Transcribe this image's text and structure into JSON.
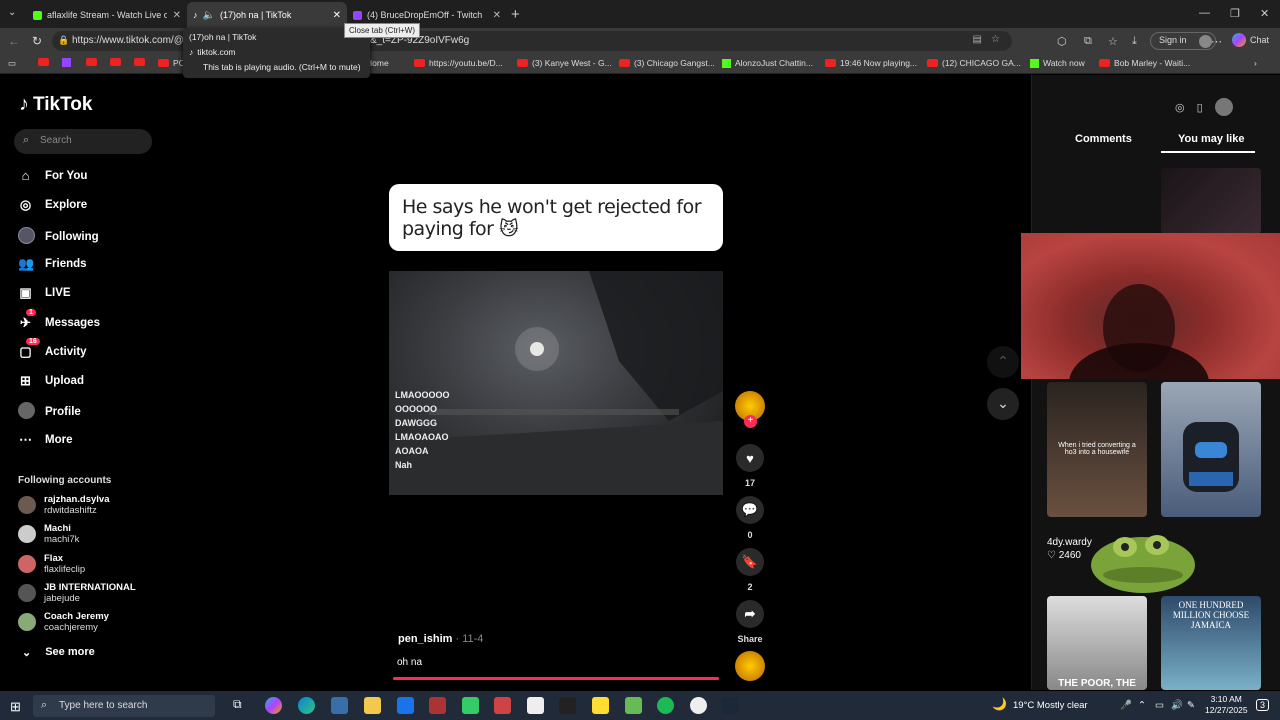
{
  "browser": {
    "tabs": [
      {
        "title": "aflaxlife Stream - Watch Live on Ki",
        "active": false
      },
      {
        "title": "(17)oh na | TikTok",
        "active": true
      },
      {
        "title": "(4) BruceDropEmOff - Twitch",
        "active": false
      }
    ],
    "close_tooltip": "Close tab (Ctrl+W)",
    "hover_card": {
      "title": "(17)oh na | TikTok",
      "domain": "tiktok.com",
      "audio_note": "This tab is playing audio. (Ctrl+M to mute)"
    },
    "url": "https://www.tiktok.com/@p",
    "url_tail": "&_t=ZP-92Z9oIVFw6g",
    "signin_label": "Sign in",
    "chat_label": "Chat",
    "bookmarks": [
      {
        "label": "PC",
        "kind": "youtube"
      },
      {
        "label": "Home",
        "kind": "plain"
      },
      {
        "label": "https://youtu.be/D...",
        "kind": "youtube"
      },
      {
        "label": "(3) Kanye West - G...",
        "kind": "youtube"
      },
      {
        "label": "(3) Chicago Gangst...",
        "kind": "youtube"
      },
      {
        "label": "AlonzoJust Chattin...",
        "kind": "kick"
      },
      {
        "label": "19:46 Now playing...",
        "kind": "youtube"
      },
      {
        "label": "(12) CHICAGO GA...",
        "kind": "youtube"
      },
      {
        "label": "Watch now",
        "kind": "kick"
      },
      {
        "label": "Bob Marley - Waiti...",
        "kind": "youtube"
      }
    ]
  },
  "tiktok": {
    "logo": "TikTok",
    "search_placeholder": "Search",
    "nav": [
      {
        "label": "For You",
        "icon": "home-icon"
      },
      {
        "label": "Explore",
        "icon": "compass-icon"
      },
      {
        "label": "Following",
        "icon": "following-icon"
      },
      {
        "label": "Friends",
        "icon": "friends-icon"
      },
      {
        "label": "LIVE",
        "icon": "live-icon"
      },
      {
        "label": "Messages",
        "icon": "messages-icon",
        "badge": "1"
      },
      {
        "label": "Activity",
        "icon": "activity-icon",
        "badge": "16"
      },
      {
        "label": "Upload",
        "icon": "upload-icon"
      },
      {
        "label": "Profile",
        "icon": "profile-icon"
      },
      {
        "label": "More",
        "icon": "more-icon"
      }
    ],
    "following_title": "Following accounts",
    "following": [
      {
        "name": "rajzhan.dsylva",
        "handle": "rdwitdashiftz"
      },
      {
        "name": "Machi",
        "handle": "machi7k"
      },
      {
        "name": "Flax",
        "handle": "flaxlifeclip"
      },
      {
        "name": "JB INTERNATIONAL",
        "handle": "jabejude"
      },
      {
        "name": "Coach Jeremy",
        "handle": "coachjeremy"
      }
    ],
    "see_more": "See more",
    "video": {
      "caption": "He says he won't get rejected for paying for 😼",
      "overlay_lines": [
        "LMAOOOOO",
        "OOOOOO",
        "DAWGGG",
        "LMAOAOAO",
        "AOAOA",
        "Nah"
      ],
      "author": "pen_ishim",
      "date": "· 11-4",
      "description": "oh na",
      "progress": 0.98,
      "likes": "17",
      "comments": "0",
      "saves": "2",
      "share_label": "Share"
    },
    "right_tabs": [
      "Comments",
      "You may like"
    ],
    "suggested_user": "4dy.wardy",
    "suggested_likes": "2460",
    "thumb_caption_1": "When i tried converting a ho3 into a housewife",
    "thumb_caption_2": "ONE HUNDRED MILLION CHOOSE JAMAICA",
    "thumb_caption_3": "THE POOR, THE RICH"
  },
  "taskbar": {
    "search_placeholder": "Type here to search",
    "weather": "19°C  Mostly clear",
    "time": "3:10 AM",
    "date": "12/27/2025",
    "notif_count": "3"
  }
}
